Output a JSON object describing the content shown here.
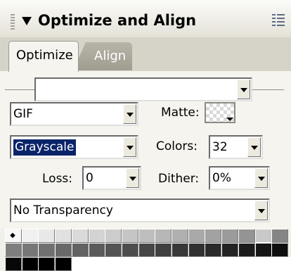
{
  "panel": {
    "title": "Optimize and Align"
  },
  "tabs": [
    {
      "label": "Optimize",
      "active": true
    },
    {
      "label": "Align",
      "active": false
    }
  ],
  "settings": {
    "preset_value": "",
    "format_value": "GIF",
    "matte_label": "Matte:",
    "palette_value": "Grayscale",
    "colors_label": "Colors:",
    "colors_value": "32",
    "loss_label": "Loss:",
    "loss_value": "0",
    "dither_label": "Dither:",
    "dither_value": "0%",
    "transparency_value": "No Transparency"
  },
  "swatches": {
    "row1": [
      "#f7f7f7",
      "#f0f0f0",
      "#e8e8e8",
      "#e1e1e1",
      "#dadada",
      "#d3d3d3",
      "#cccccc",
      "#c5c5c5",
      "#bebebe",
      "#b7b7b7",
      "#b0b0b0",
      "#a9a9a9",
      "#a2a2a2",
      "#9b9b9b",
      "#949494",
      "#8d8d8d",
      "#858585"
    ],
    "row2": [
      "#7e7e7e",
      "#777777",
      "#707070",
      "#696969",
      "#626262",
      "#5b5b5b",
      "#545454",
      "#4d4d4d",
      "#464646",
      "#3f3f3f",
      "#383838",
      "#313131",
      "#2a2a2a",
      "#232323",
      "#1c1c1c",
      "#151515",
      "#0e0e0e"
    ],
    "row3": [
      "#070707",
      "#000000",
      "#000000",
      "#000000",
      "#ffffff"
    ]
  },
  "icons": {
    "collapse": "triangle-down-icon",
    "menu": "panel-menu-icon",
    "grip": "drag-grip-icon"
  }
}
